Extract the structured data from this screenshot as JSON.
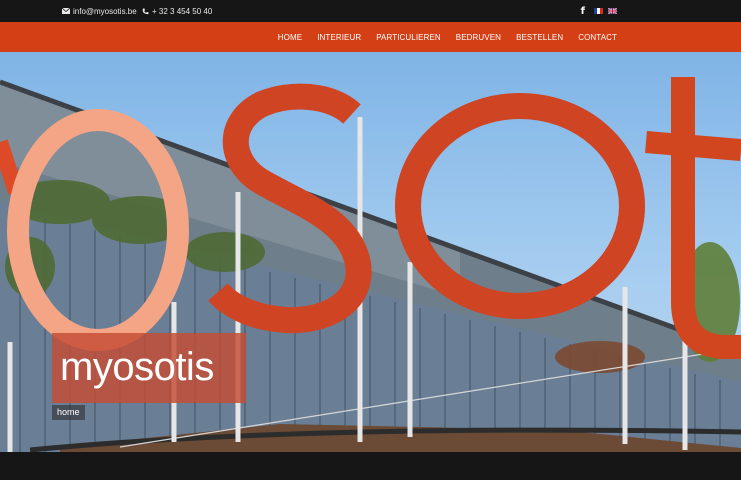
{
  "topbar": {
    "email": "info@myosotis.be",
    "phone": "+ 32 3 454 50 40",
    "social_icon": "facebook-icon",
    "languages": [
      "fr-flag-icon",
      "en-flag-icon"
    ]
  },
  "nav": {
    "items": [
      "HOME",
      "INTERIEUR",
      "PARTICULIEREN",
      "BEDRUVEN",
      "BESTELLEN",
      "CONTACT"
    ]
  },
  "hero": {
    "title": "myosotis",
    "breadcrumb": "home"
  },
  "colors": {
    "brand": "#d43f16",
    "topbar": "#161616",
    "caption_bg": "#c44c34"
  }
}
